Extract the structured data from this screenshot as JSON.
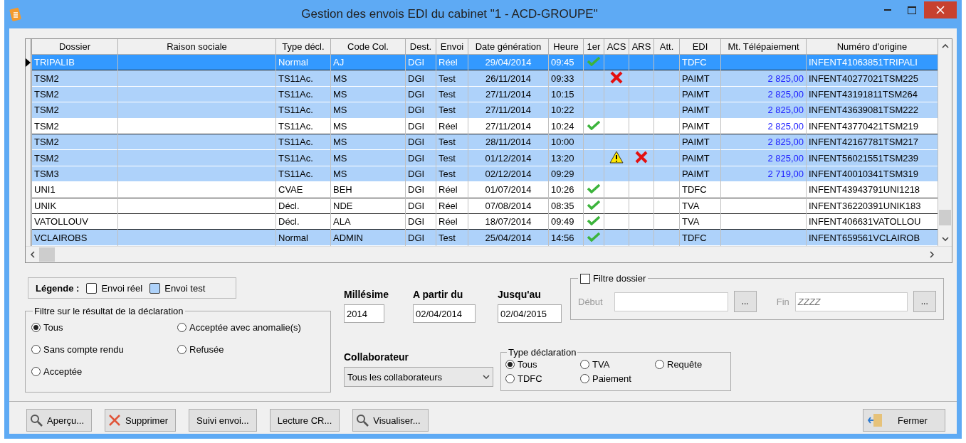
{
  "window": {
    "title": "Gestion des envois EDI du cabinet \"1 - ACD-GROUPE\""
  },
  "table": {
    "columns": [
      "Dossier",
      "Raison sociale",
      "Type décl.",
      "Code Col.",
      "Dest.",
      "Envoi",
      "Date génération",
      "Heure",
      "1er",
      "ACS",
      "ARS",
      "Att.",
      "EDI",
      "Mt. Télépaiement",
      "Numéro d'origine"
    ],
    "rows": [
      {
        "kind": "real",
        "selected": true,
        "dossier": "TRIPALIB",
        "type": "Normal",
        "code": "AJ",
        "dest": "DGI",
        "envoi": "Réel",
        "date": "29/04/2014",
        "heure": "09:45",
        "first_ok": true,
        "acs_error": false,
        "acs_warning": false,
        "ars_error": false,
        "edi": "TDFC",
        "numero": "INFENT41063851TRIPALI"
      },
      {
        "kind": "test",
        "selected": false,
        "dossier": "TSM2",
        "type": "TS11Ac.",
        "code": "MS",
        "dest": "DGI",
        "envoi": "Test",
        "date": "26/11/2014",
        "heure": "09:33",
        "first_ok": false,
        "acs_error": true,
        "acs_warning": false,
        "ars_error": false,
        "edi": "PAIMT",
        "amount": "2 825,00",
        "numero": "INFENT40277021TSM225"
      },
      {
        "kind": "test",
        "selected": false,
        "dossier": "TSM2",
        "type": "TS11Ac.",
        "code": "MS",
        "dest": "DGI",
        "envoi": "Test",
        "date": "27/11/2014",
        "heure": "10:15",
        "first_ok": false,
        "acs_error": false,
        "acs_warning": false,
        "ars_error": false,
        "edi": "PAIMT",
        "amount": "2 825,00",
        "numero": "INFENT43191811TSM264"
      },
      {
        "kind": "test",
        "selected": false,
        "dossier": "TSM2",
        "type": "TS11Ac.",
        "code": "MS",
        "dest": "DGI",
        "envoi": "Test",
        "date": "27/11/2014",
        "heure": "10:22",
        "first_ok": false,
        "acs_error": false,
        "acs_warning": false,
        "ars_error": false,
        "edi": "PAIMT",
        "amount": "2 825,00",
        "numero": "INFENT43639081TSM222"
      },
      {
        "kind": "real",
        "selected": false,
        "dossier": "TSM2",
        "type": "TS11Ac.",
        "code": "MS",
        "dest": "DGI",
        "envoi": "Réel",
        "date": "27/11/2014",
        "heure": "10:24",
        "first_ok": true,
        "acs_error": false,
        "acs_warning": false,
        "ars_error": false,
        "edi": "PAIMT",
        "amount": "2 825,00",
        "numero": "INFENT43770421TSM219"
      },
      {
        "kind": "test",
        "selected": false,
        "dossier": "TSM2",
        "type": "TS11Ac.",
        "code": "MS",
        "dest": "DGI",
        "envoi": "Test",
        "date": "28/11/2014",
        "heure": "10:00",
        "first_ok": false,
        "acs_error": false,
        "acs_warning": false,
        "ars_error": false,
        "edi": "PAIMT",
        "amount": "2 825,00",
        "numero": "INFENT42167781TSM217"
      },
      {
        "kind": "test",
        "selected": false,
        "dossier": "TSM2",
        "type": "TS11Ac.",
        "code": "MS",
        "dest": "DGI",
        "envoi": "Test",
        "date": "01/12/2014",
        "heure": "13:20",
        "first_ok": false,
        "acs_error": false,
        "acs_warning": true,
        "ars_error": true,
        "edi": "PAIMT",
        "amount": "2 825,00",
        "numero": "INFENT56021551TSM239"
      },
      {
        "kind": "test",
        "selected": false,
        "dossier": "TSM3",
        "type": "TS11Ac.",
        "code": "MS",
        "dest": "DGI",
        "envoi": "Test",
        "date": "02/12/2014",
        "heure": "09:29",
        "first_ok": false,
        "acs_error": false,
        "acs_warning": false,
        "ars_error": false,
        "edi": "PAIMT",
        "amount": "2 719,00",
        "numero": "INFENT40010341TSM319"
      },
      {
        "kind": "real",
        "selected": false,
        "dossier": "UNI1",
        "type": "CVAE",
        "code": "BEH",
        "dest": "DGI",
        "envoi": "Réel",
        "date": "01/07/2014",
        "heure": "10:26",
        "first_ok": true,
        "acs_error": false,
        "acs_warning": false,
        "ars_error": false,
        "edi": "TDFC",
        "numero": "INFENT43943791UNI1218"
      },
      {
        "kind": "real",
        "selected": false,
        "dossier": "UNIK",
        "type": "Décl.",
        "code": "NDE",
        "dest": "DGI",
        "envoi": "Réel",
        "date": "07/08/2014",
        "heure": "08:35",
        "first_ok": true,
        "acs_error": false,
        "acs_warning": false,
        "ars_error": false,
        "edi": "TVA",
        "numero": "INFENT36220391UNIK183"
      },
      {
        "kind": "real",
        "selected": false,
        "dossier": "VATOLLOUV",
        "type": "Décl.",
        "code": "ALA",
        "dest": "DGI",
        "envoi": "Réel",
        "date": "18/07/2014",
        "heure": "09:49",
        "first_ok": true,
        "acs_error": false,
        "acs_warning": false,
        "ars_error": false,
        "edi": "TVA",
        "numero": "INFENT406631VATOLLOU"
      },
      {
        "kind": "test",
        "selected": false,
        "dossier": "VCLAIROBS",
        "type": "Normal",
        "code": "ADMIN",
        "dest": "DGI",
        "envoi": "Test",
        "date": "25/04/2014",
        "heure": "14:56",
        "first_ok": true,
        "acs_error": false,
        "acs_warning": false,
        "ars_error": false,
        "edi": "TDFC",
        "numero": "INFENT659561VCLAIROB"
      }
    ]
  },
  "legend": {
    "title": "Légende :",
    "items": [
      {
        "kind": "real",
        "label": "Envoi réel"
      },
      {
        "kind": "test",
        "label": "Envoi test"
      }
    ]
  },
  "result_filter": {
    "title": "Filtre sur le résultat de la déclaration",
    "options": [
      {
        "label": "Tous",
        "selected": true
      },
      {
        "label": "Acceptée avec anomalie(s)",
        "selected": false
      },
      {
        "label": "Sans compte rendu",
        "selected": false
      },
      {
        "label": "Refusée",
        "selected": false
      },
      {
        "label": "Acceptée",
        "selected": false
      }
    ]
  },
  "millesime": {
    "label": "Millésime",
    "value": "2014"
  },
  "from": {
    "label": "A partir du",
    "value": "02/04/2014"
  },
  "to": {
    "label": "Jusqu'au",
    "value": "02/04/2015"
  },
  "folder_filter": {
    "label": "Filtre dossier",
    "checked": false,
    "start_label": "Début",
    "browse_1": "...",
    "end_label": "Fin",
    "end_value": "ZZZZ",
    "browse_2": "..."
  },
  "collaborator": {
    "label": "Collaborateur",
    "value": "Tous les collaborateurs"
  },
  "type_filter": {
    "title": "Type déclaration",
    "options": [
      {
        "label": "Tous",
        "selected": true
      },
      {
        "label": "TVA",
        "selected": false
      },
      {
        "label": "Requête",
        "selected": false
      },
      {
        "label": "TDFC",
        "selected": false
      },
      {
        "label": "Paiement",
        "selected": false
      }
    ]
  },
  "buttons": [
    {
      "kind": "search",
      "label": "Aperçu..."
    },
    {
      "kind": "delete",
      "label": "Supprimer"
    },
    {
      "kind": "plain",
      "label": "Suivi envoi..."
    },
    {
      "kind": "plain",
      "label": "Lecture CR..."
    },
    {
      "kind": "search",
      "label": "Visualiser..."
    }
  ],
  "close_button": {
    "label": "Fermer"
  }
}
